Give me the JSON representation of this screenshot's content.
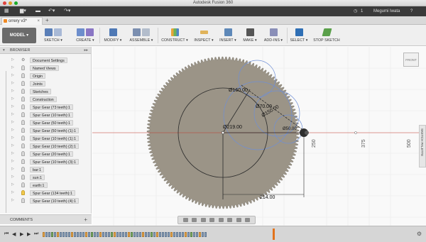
{
  "app": {
    "window_title": "Autodesk Fusion 360",
    "user_name": "Megumi Iwata",
    "notification_count": "1",
    "help_label": "?"
  },
  "tab": {
    "document_name": "orrery v3*",
    "close_label": "×",
    "add_label": "+"
  },
  "toolbar": {
    "workspace_label": "MODEL ▾",
    "groups": [
      {
        "label": "SKETCH ▾"
      },
      {
        "label": "CREATE ▾"
      },
      {
        "label": "MODIFY ▾"
      },
      {
        "label": "ASSEMBLE ▾"
      },
      {
        "label": "CONSTRUCT ▾"
      },
      {
        "label": "INSPECT ▾"
      },
      {
        "label": "INSERT ▾"
      },
      {
        "label": "MAKE ▾"
      },
      {
        "label": "ADD-INS ▾"
      },
      {
        "label": "SELECT ▾"
      },
      {
        "label": "STOP SKETCH"
      }
    ],
    "colors": {
      "accent_blue": "#2f6fb5",
      "stop_sketch_green": "#5aa04a"
    }
  },
  "browser": {
    "title": "BROWSER",
    "items": [
      {
        "label": "Document Settings"
      },
      {
        "label": "Named Views"
      },
      {
        "label": "Origin"
      },
      {
        "label": "Joints"
      },
      {
        "label": "Sketches"
      },
      {
        "label": "Construction"
      },
      {
        "label": "Spur Gear (73 teeth):1"
      },
      {
        "label": "Spur Gear (10 teeth):1"
      },
      {
        "label": "Spur Gear (50 teeth):1"
      },
      {
        "label": "Spur Gear (50 teeth) (1):1"
      },
      {
        "label": "Spur Gear (10 teeth) (1):1"
      },
      {
        "label": "Spur Gear (10 teeth) (2):1"
      },
      {
        "label": "Spur Gear (20 teeth):1"
      },
      {
        "label": "Spur Gear (10 teeth) (3):1"
      },
      {
        "label": "bar:1"
      },
      {
        "label": "sun:1"
      },
      {
        "label": "earth:1"
      },
      {
        "label": "Spur Gear (134 teeth):1"
      },
      {
        "label": "Spur Gear (10 teeth) (4):1"
      }
    ]
  },
  "comments": {
    "title": "COMMENTS",
    "add_label": "+"
  },
  "canvas": {
    "viewcube_label": "FRONT",
    "sketch_palette_label": "SKETCH PALETTE",
    "dimensions": {
      "d_large": "Ø219.00",
      "d_mid1": "Ø160.00",
      "d_mid2": "Ø150.00",
      "d_small": "Ø70.00",
      "d_tiny": "Ø50.00",
      "horizontal": "214.00",
      "axis_250": "250",
      "axis_375": "375",
      "axis_500": "500"
    },
    "colors": {
      "gear_fill": "#9b9487",
      "sketch_line": "#2b2b2b",
      "construction_blue": "#6f8fd6",
      "axis_red": "#c0392b"
    }
  },
  "timeline": {
    "controls": [
      "⏮",
      "◀",
      "▶",
      "▶",
      "⏭"
    ],
    "settings_icon": "gear-icon"
  }
}
